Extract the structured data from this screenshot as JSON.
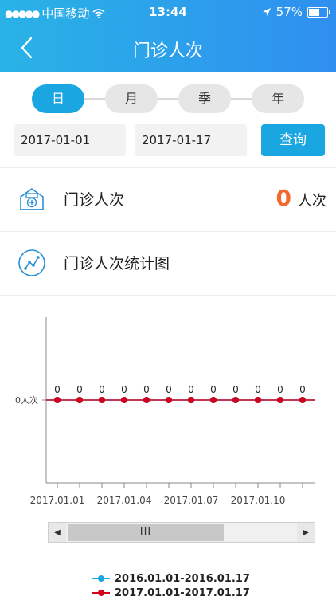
{
  "status_bar": {
    "signal": "●●●●●",
    "carrier": "中国移动",
    "time": "13:44",
    "battery_text": "57%",
    "battery_level": 0.57
  },
  "nav": {
    "title": "门诊人次"
  },
  "period_tabs": [
    {
      "label": "日",
      "active": true
    },
    {
      "label": "月",
      "active": false
    },
    {
      "label": "季",
      "active": false
    },
    {
      "label": "年",
      "active": false
    }
  ],
  "filters": {
    "start_date": "2017-01-01",
    "end_date": "2017-01-17",
    "query_label": "查询"
  },
  "summary": {
    "label": "门诊人次",
    "value": "0",
    "unit": "人次"
  },
  "chart_section": {
    "label": "门诊人次统计图"
  },
  "colors": {
    "accent": "#1aa6e0",
    "value": "#f26a2e",
    "series_current": "#d0021b",
    "series_previous": "#1aa6e0"
  },
  "chart_data": {
    "type": "line",
    "y_ticks": [
      {
        "value": 0,
        "label": "0人次"
      }
    ],
    "x_tick_labels": [
      "2017.01.01",
      "2017.01.04",
      "2017.01.07",
      "2017.01.10"
    ],
    "x_index": [
      1,
      2,
      3,
      4,
      5,
      6,
      7,
      8,
      9,
      10,
      11,
      12
    ],
    "series": [
      {
        "name": "2016.01.01-2016.01.17",
        "values": [
          0,
          0,
          0,
          0,
          0,
          0,
          0,
          0,
          0,
          0,
          0,
          0
        ]
      },
      {
        "name": "2017.01.01-2017.01.17",
        "values": [
          0,
          0,
          0,
          0,
          0,
          0,
          0,
          0,
          0,
          0,
          0,
          0
        ]
      }
    ],
    "data_labels": [
      "0",
      "0",
      "0",
      "0",
      "0",
      "0",
      "0",
      "0",
      "0",
      "0",
      "0",
      "0"
    ],
    "legend_position": "bottom",
    "scrollbar": {
      "thumb_label": "III"
    }
  }
}
